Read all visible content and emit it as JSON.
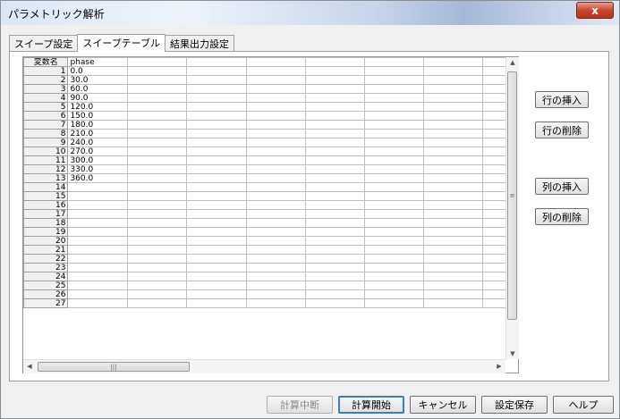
{
  "window": {
    "title": "パラメトリック解析",
    "close_label": "x"
  },
  "tabs": [
    {
      "label": "スイープ設定"
    },
    {
      "label": "スイープテーブル"
    },
    {
      "label": "結果出力設定"
    }
  ],
  "grid": {
    "corner_label": "変数名",
    "column_header": "phase",
    "rows": [
      {
        "num": "1",
        "value": "0.0"
      },
      {
        "num": "2",
        "value": "30.0"
      },
      {
        "num": "3",
        "value": "60.0"
      },
      {
        "num": "4",
        "value": "90.0"
      },
      {
        "num": "5",
        "value": "120.0"
      },
      {
        "num": "6",
        "value": "150.0"
      },
      {
        "num": "7",
        "value": "180.0"
      },
      {
        "num": "8",
        "value": "210.0"
      },
      {
        "num": "9",
        "value": "240.0"
      },
      {
        "num": "10",
        "value": "270.0"
      },
      {
        "num": "11",
        "value": "300.0"
      },
      {
        "num": "12",
        "value": "330.0"
      },
      {
        "num": "13",
        "value": "360.0"
      },
      {
        "num": "14",
        "value": ""
      },
      {
        "num": "15",
        "value": ""
      },
      {
        "num": "16",
        "value": ""
      },
      {
        "num": "17",
        "value": ""
      },
      {
        "num": "18",
        "value": ""
      },
      {
        "num": "19",
        "value": ""
      },
      {
        "num": "20",
        "value": ""
      },
      {
        "num": "21",
        "value": ""
      },
      {
        "num": "22",
        "value": ""
      },
      {
        "num": "23",
        "value": ""
      },
      {
        "num": "24",
        "value": ""
      },
      {
        "num": "25",
        "value": ""
      },
      {
        "num": "26",
        "value": ""
      },
      {
        "num": "27",
        "value": ""
      }
    ]
  },
  "side_buttons": {
    "insert_row": "行の挿入",
    "delete_row": "行の削除",
    "insert_col": "列の挿入",
    "delete_col": "列の削除"
  },
  "bottom_buttons": {
    "stop": "計算中断",
    "start": "計算開始",
    "cancel": "キャンセル",
    "save": "設定保存",
    "help": "ヘルプ"
  }
}
